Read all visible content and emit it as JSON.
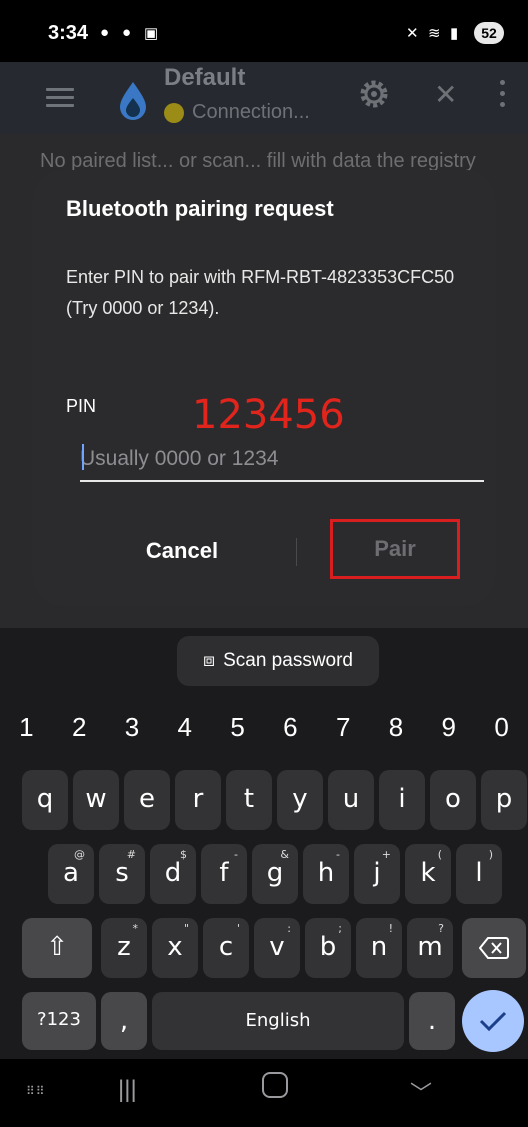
{
  "status_bar": {
    "time": "3:34",
    "battery": "52"
  },
  "app_bar": {
    "title": "Default",
    "subtitle": "Connection..."
  },
  "background_text": "No paired list... or scan... fill with data the registry",
  "dialog": {
    "title": "Bluetooth pairing request",
    "message": "Enter PIN to pair with RFM-RBT-4823353CFC50 (Try 0000 or 1234).",
    "pin_label": "PIN",
    "pin_annotation": "123456",
    "pin_placeholder": "Usually 0000 or 1234",
    "cancel_label": "Cancel",
    "pair_label": "Pair"
  },
  "keyboard": {
    "scan_label": "Scan password",
    "numbers": [
      "1",
      "2",
      "3",
      "4",
      "5",
      "6",
      "7",
      "8",
      "9",
      "0"
    ],
    "row1": [
      "q",
      "w",
      "e",
      "r",
      "t",
      "y",
      "u",
      "i",
      "o",
      "p"
    ],
    "row2": [
      [
        "a",
        "@"
      ],
      [
        "s",
        "#"
      ],
      [
        "d",
        "$"
      ],
      [
        "f",
        "-"
      ],
      [
        "g",
        "&"
      ],
      [
        "h",
        "-"
      ],
      [
        "j",
        "+"
      ],
      [
        "k",
        "("
      ],
      [
        "l",
        ")"
      ]
    ],
    "row3": [
      [
        "z",
        "*"
      ],
      [
        "x",
        "\""
      ],
      [
        "c",
        "'"
      ],
      [
        "v",
        ":"
      ],
      [
        "b",
        ";"
      ],
      [
        "n",
        "!"
      ],
      [
        "m",
        "?"
      ]
    ],
    "sym_label": "?123",
    "comma": ",",
    "space_label": "English",
    "period": "."
  },
  "colors": {
    "accent_blue": "#6fa5ff",
    "annotation_red": "#e1241c",
    "connection_dot": "#9a8c17"
  }
}
